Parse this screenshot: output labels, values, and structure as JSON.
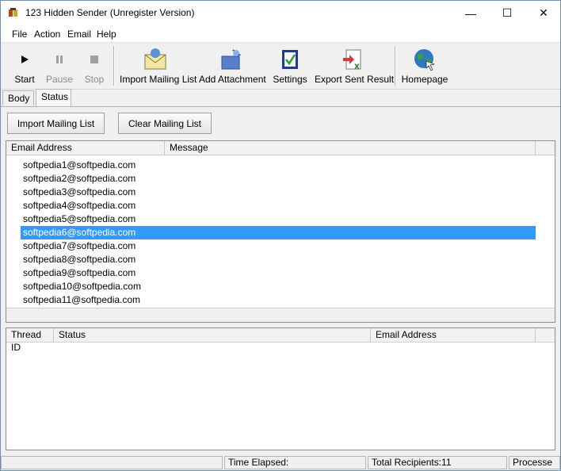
{
  "window": {
    "title": "123 Hidden Sender (Unregister Version)",
    "controls": {
      "minimize": "—",
      "maximize": "☐",
      "close": "✕"
    }
  },
  "menu": [
    "File",
    "Action",
    "Email",
    "Help"
  ],
  "toolbar": {
    "start": "Start",
    "pause": "Pause",
    "stop": "Stop",
    "import": "Import Mailing List",
    "attachment": "Add Attachment",
    "settings": "Settings",
    "export": "Export Sent Result",
    "homepage": "Homepage"
  },
  "tabs": [
    "Body",
    "Status"
  ],
  "status_panel": {
    "import_button": "Import Mailing List",
    "clear_button": "Clear Mailing List",
    "columns": [
      "Email Address",
      "Message"
    ],
    "emails": [
      "softpedia1@softpedia.com",
      "softpedia2@softpedia.com",
      "softpedia3@softpedia.com",
      "softpedia4@softpedia.com",
      "softpedia5@softpedia.com",
      "softpedia6@softpedia.com",
      "softpedia7@softpedia.com",
      "softpedia8@softpedia.com",
      "softpedia9@softpedia.com",
      "softpedia10@softpedia.com",
      "softpedia11@softpedia.com"
    ],
    "selected_email": "softpedia6@softpedia.com",
    "thread_columns": [
      "Thread ID",
      "Status",
      "Email Address"
    ]
  },
  "statusbar": {
    "time_elapsed": "Time Elapsed:",
    "total_recipients": "Total Recipients:11",
    "processed": "Processe"
  },
  "colors": {
    "selection": "#3399ff",
    "window_border": "#6d8fb4"
  }
}
